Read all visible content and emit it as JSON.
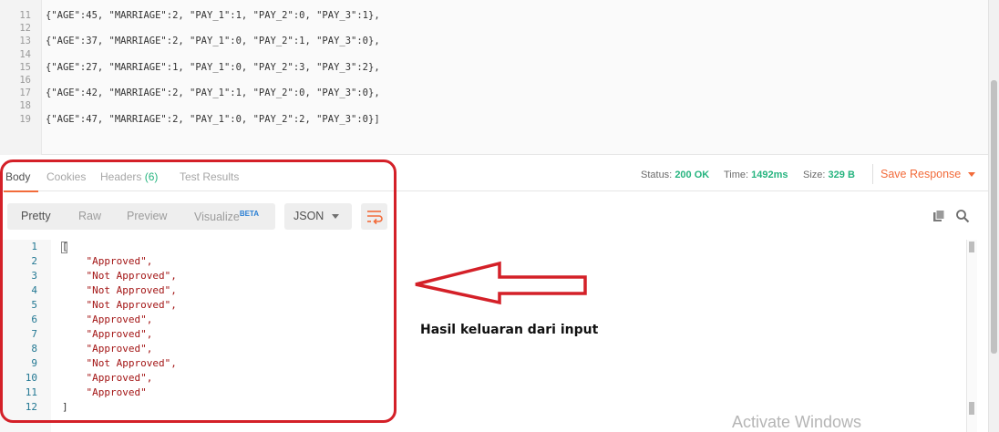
{
  "request_editor": {
    "lines": [
      {
        "num": "11",
        "code": "{\"AGE\":45, \"MARRIAGE\":2, \"PAY_1\":1, \"PAY_2\":0, \"PAY_3\":1},"
      },
      {
        "num": "12",
        "code": ""
      },
      {
        "num": "13",
        "code": "{\"AGE\":37, \"MARRIAGE\":2, \"PAY_1\":0, \"PAY_2\":1, \"PAY_3\":0},"
      },
      {
        "num": "14",
        "code": ""
      },
      {
        "num": "15",
        "code": "{\"AGE\":27, \"MARRIAGE\":1, \"PAY_1\":0, \"PAY_2\":3, \"PAY_3\":2},"
      },
      {
        "num": "16",
        "code": ""
      },
      {
        "num": "17",
        "code": "{\"AGE\":42, \"MARRIAGE\":2, \"PAY_1\":1, \"PAY_2\":0, \"PAY_3\":0},"
      },
      {
        "num": "18",
        "code": ""
      },
      {
        "num": "19",
        "code": "{\"AGE\":47, \"MARRIAGE\":2, \"PAY_1\":0, \"PAY_2\":2, \"PAY_3\":0}]"
      }
    ]
  },
  "response_tabs": {
    "body": "Body",
    "cookies": "Cookies",
    "headers": "Headers",
    "headers_count": "(6)",
    "test_results": "Test Results"
  },
  "status": {
    "status_label": "Status:",
    "status_value": "200 OK",
    "time_label": "Time:",
    "time_value": "1492ms",
    "size_label": "Size:",
    "size_value": "329 B",
    "save_response": "Save Response"
  },
  "view_modes": {
    "pretty": "Pretty",
    "raw": "Raw",
    "preview": "Preview",
    "visualize": "Visualize",
    "beta": "BETA"
  },
  "format_select": "JSON",
  "response_editor": {
    "lines": [
      {
        "num": "1",
        "code": "[",
        "kind": "bracket"
      },
      {
        "num": "2",
        "code": "    \"Approved\",",
        "kind": "string"
      },
      {
        "num": "3",
        "code": "    \"Not Approved\",",
        "kind": "string"
      },
      {
        "num": "4",
        "code": "    \"Not Approved\",",
        "kind": "string"
      },
      {
        "num": "5",
        "code": "    \"Not Approved\",",
        "kind": "string"
      },
      {
        "num": "6",
        "code": "    \"Approved\",",
        "kind": "string"
      },
      {
        "num": "7",
        "code": "    \"Approved\",",
        "kind": "string"
      },
      {
        "num": "8",
        "code": "    \"Approved\",",
        "kind": "string"
      },
      {
        "num": "9",
        "code": "    \"Not Approved\",",
        "kind": "string"
      },
      {
        "num": "10",
        "code": "    \"Approved\",",
        "kind": "string"
      },
      {
        "num": "11",
        "code": "    \"Approved\"",
        "kind": "string"
      },
      {
        "num": "12",
        "code": "]",
        "kind": "bracket"
      }
    ]
  },
  "annotation": {
    "text": "Hasil keluaran dari input",
    "color": "#d42028"
  },
  "watermark": "Activate Windows",
  "colors": {
    "accent": "#f26b3a",
    "success": "#26b47f",
    "string": "#a31515",
    "line_number": "#237893"
  },
  "icons": [
    "copy-icon",
    "search-icon",
    "wrap-lines-icon",
    "chevron-down-icon"
  ]
}
